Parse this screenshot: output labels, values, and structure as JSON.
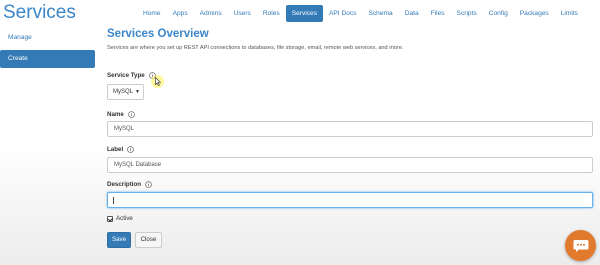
{
  "app": {
    "title": "Services"
  },
  "nav": {
    "items": [
      "Home",
      "Apps",
      "Admins",
      "Users",
      "Roles",
      "Services",
      "API Docs",
      "Schema",
      "Data",
      "Files",
      "Scripts",
      "Config",
      "Packages",
      "Limits"
    ],
    "active": "Services"
  },
  "sidebar": {
    "items": [
      {
        "label": "Manage",
        "active": false
      },
      {
        "label": "Create",
        "active": true
      }
    ]
  },
  "main": {
    "title": "Services Overview",
    "description": "Services are where you set up REST API connections to databases, file storage, email, remote web services, and more."
  },
  "form": {
    "service_type": {
      "label": "Service Type",
      "value": "MySQL"
    },
    "name": {
      "label": "Name",
      "value": "MySQL"
    },
    "service_label": {
      "label": "Label",
      "value": "MySQL Database"
    },
    "description": {
      "label": "Description",
      "value": ""
    },
    "active": {
      "label": "Active",
      "checked": true
    },
    "save_label": "Save",
    "close_label": "Close"
  },
  "colors": {
    "accent": "#337ab7",
    "title": "#3a86c8",
    "chat_button": "#e27a2d",
    "cursor_highlight": "#fff050"
  },
  "icons": {
    "help": "info-circle-icon",
    "chat": "chat-bubble-icon",
    "caret": "caret-down-icon",
    "pointer": "mouse-pointer-icon"
  }
}
